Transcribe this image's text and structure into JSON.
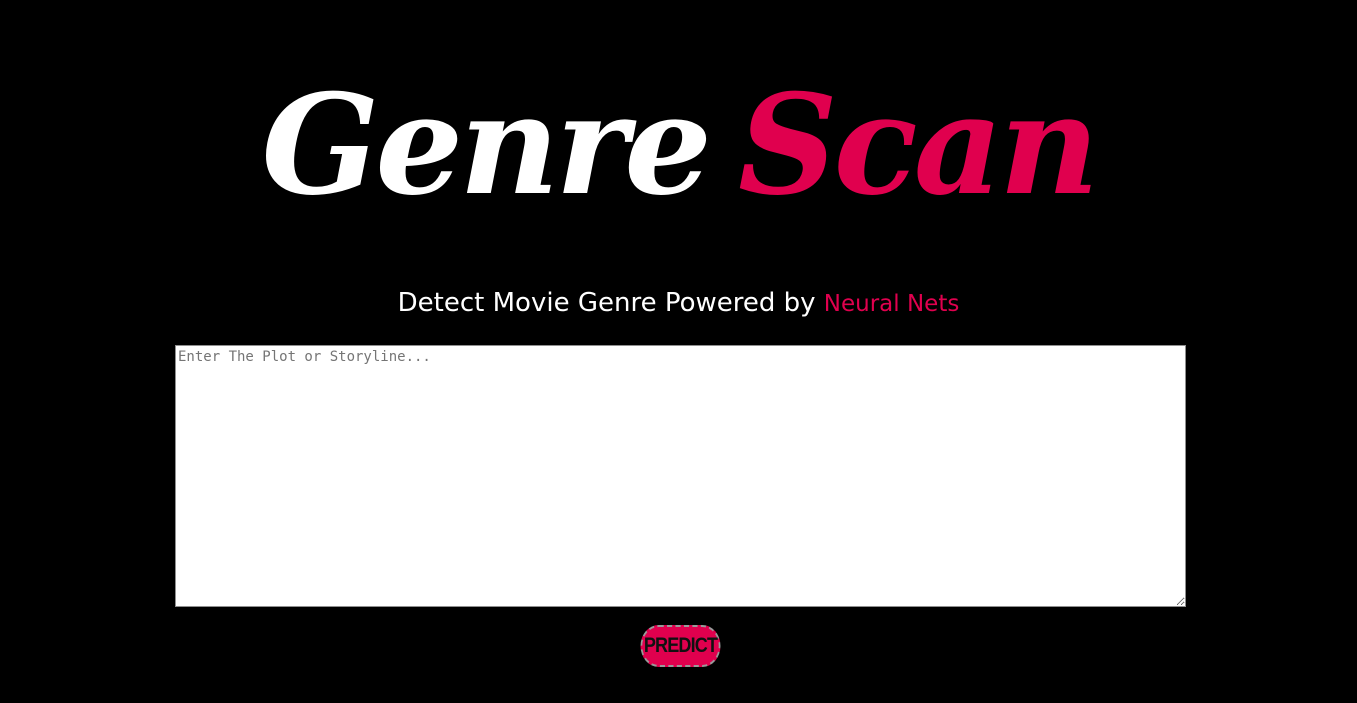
{
  "header": {
    "logo_word_1": "Genre",
    "logo_word_2": "Scan"
  },
  "tagline": {
    "text": "Detect Movie Genre Powered by",
    "accent": "Neural Nets"
  },
  "form": {
    "plot_placeholder": "Enter The Plot or Storyline...",
    "plot_value": "",
    "predict_label": "PREDICT"
  },
  "colors": {
    "background": "#000000",
    "accent": "#e0004e",
    "text": "#ffffff"
  }
}
